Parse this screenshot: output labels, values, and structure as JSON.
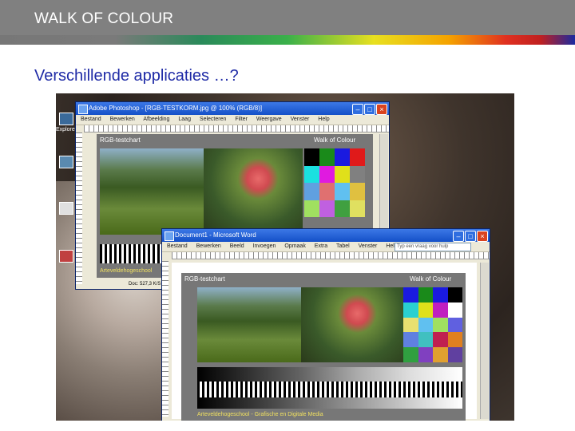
{
  "header": {
    "title": "WALK OF COLOUR"
  },
  "slide": {
    "subtitle": "Verschillende applicaties …?"
  },
  "desktop": {
    "icons": [
      "Explorer"
    ]
  },
  "photoshop": {
    "title": "Adobe Photoshop - [RGB-TESTKORM.jpg @ 100% (RGB/8)]",
    "menu": [
      "Bestand",
      "Bewerken",
      "Afbeelding",
      "Laag",
      "Selecteren",
      "Filter",
      "Weergave",
      "Venster",
      "Help"
    ],
    "chart_left": "RGB-testchart",
    "chart_right": "Walk of Colour",
    "footer": "Arteveldehogeschool",
    "status": "Doc: 527,3 K/S"
  },
  "word": {
    "title": "Document1 - Microsoft Word",
    "menu": [
      "Bestand",
      "Bewerken",
      "Beeld",
      "Invoegen",
      "Opmaak",
      "Extra",
      "Tabel",
      "Venster",
      "Help"
    ],
    "help_box": "Typ een vraag voor hulp",
    "chart_left": "RGB-testchart",
    "chart_right": "Walk of Colour",
    "footer": "Arteveldehogeschool - Grafische en Digitale Media"
  },
  "colors": {
    "swatches_ps": [
      "#000000",
      "#1a8a1a",
      "#1a1ae0",
      "#e01a1a",
      "#1ae0e0",
      "#e01ae0",
      "#e0e01a",
      "#808080",
      "#60a0e0",
      "#e07070",
      "#60c0f0",
      "#e0c040",
      "#a0e060",
      "#c060e0",
      "#40a040",
      "#e0e060"
    ],
    "swatches_word": [
      "#1a1ae0",
      "#1a8a1a",
      "#1a1ae0",
      "#000000",
      "#2ad0d0",
      "#e0e01a",
      "#c020c0",
      "#ffffff",
      "#e8e070",
      "#60c0f0",
      "#a0e060",
      "#6060e0",
      "#6080e0",
      "#40c0c0",
      "#c02050",
      "#e08020",
      "#30a040",
      "#8040c0",
      "#e0a030",
      "#6040a0"
    ]
  }
}
